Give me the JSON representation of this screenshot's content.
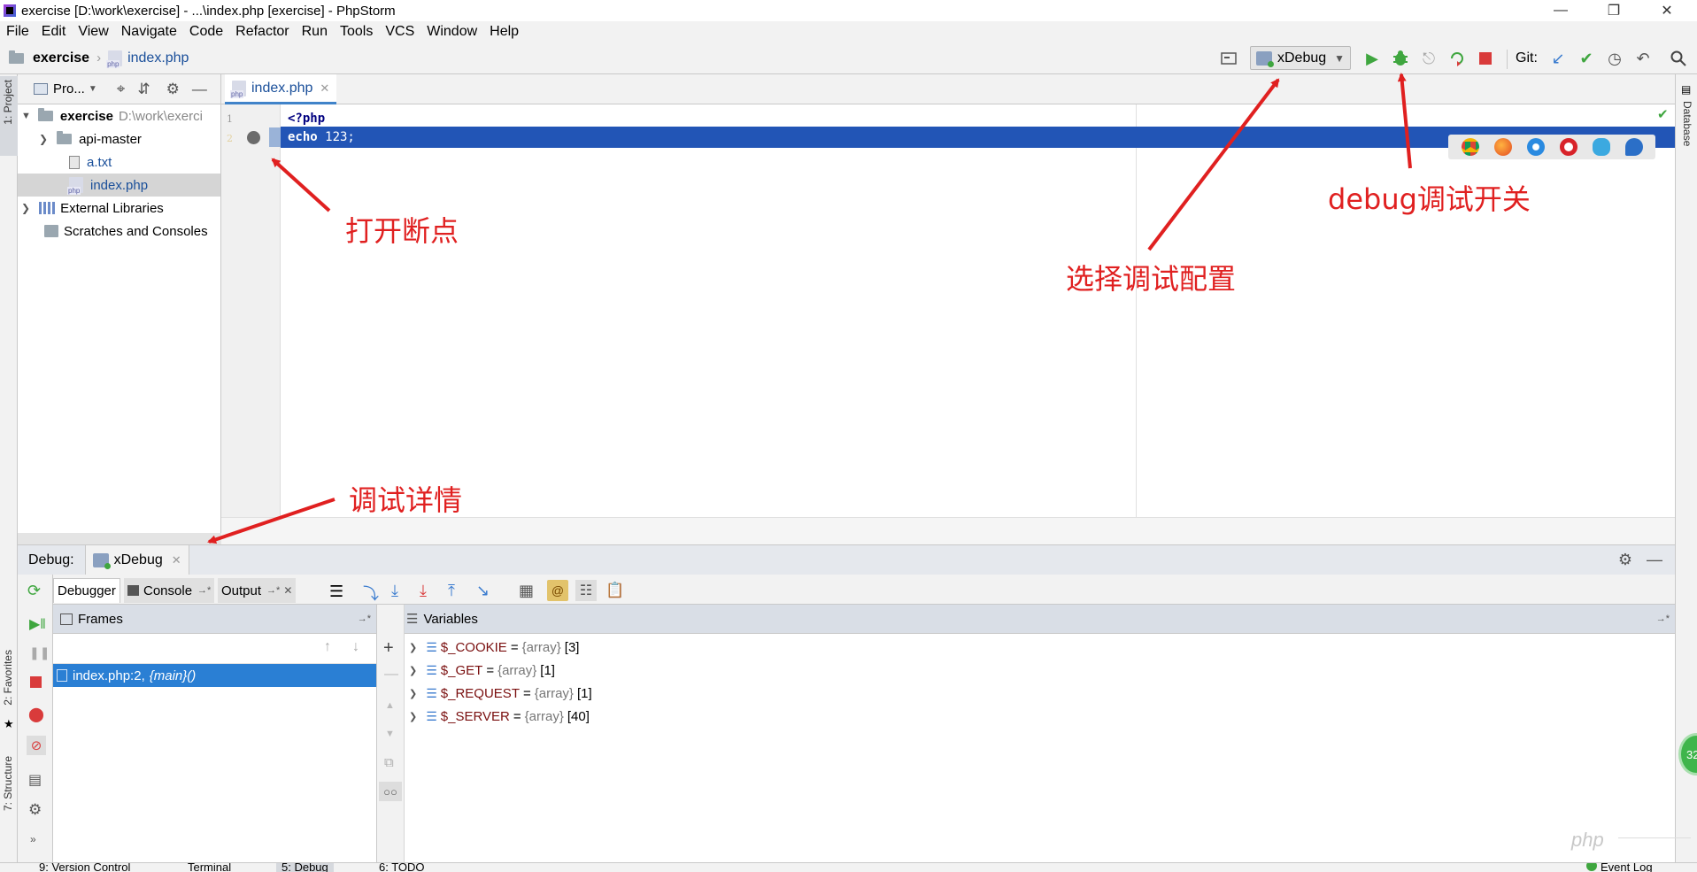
{
  "window": {
    "title": "exercise [D:\\work\\exercise] - ...\\index.php [exercise] - PhpStorm"
  },
  "menu": [
    "File",
    "Edit",
    "View",
    "Navigate",
    "Code",
    "Refactor",
    "Run",
    "Tools",
    "VCS",
    "Window",
    "Help"
  ],
  "breadcrumb": {
    "project": "exercise",
    "file": "index.php"
  },
  "toolbar": {
    "config_name": "xDebug",
    "git_label": "Git:"
  },
  "left_strip": {
    "project": "1: Project",
    "favorites": "2: Favorites",
    "structure": "7: Structure"
  },
  "right_strip": {
    "database": "Database"
  },
  "project_panel": {
    "header": "Pro...",
    "tree": [
      {
        "label": "exercise",
        "path": "D:\\work\\exerci"
      },
      {
        "label": "api-master"
      },
      {
        "label": "a.txt"
      },
      {
        "label": "index.php"
      },
      {
        "label": "External Libraries"
      },
      {
        "label": "Scratches and Consoles"
      }
    ]
  },
  "editor": {
    "tab": "index.php",
    "lines": [
      {
        "num": "1",
        "code": "<?php"
      },
      {
        "num": "2",
        "kw": "echo",
        "code": " 123;"
      }
    ]
  },
  "debug": {
    "label": "Debug:",
    "config": "xDebug",
    "tabs": {
      "debugger": "Debugger",
      "console": "Console",
      "output": "Output"
    },
    "frames": {
      "header": "Frames",
      "items": [
        {
          "file": "index.php:2,",
          "func": "{main}()"
        }
      ]
    },
    "variables": {
      "header": "Variables",
      "items": [
        {
          "name": "$_COOKIE",
          "type": "{array}",
          "count": "[3]"
        },
        {
          "name": "$_GET",
          "type": "{array}",
          "count": "[1]"
        },
        {
          "name": "$_REQUEST",
          "type": "{array}",
          "count": "[1]"
        },
        {
          "name": "$_SERVER",
          "type": "{array}",
          "count": "[40]"
        }
      ]
    }
  },
  "statusbar": {
    "vcs": "9: Version Control",
    "terminal": "Terminal",
    "debug": "5: Debug",
    "todo": "6: TODO",
    "eventlog": "Event Log"
  },
  "badge": {
    "count": "32"
  },
  "watermark": "php",
  "annotations": {
    "breakpoint": "打开断点",
    "config": "选择调试配置",
    "debug_switch": "debug调试开关",
    "details": "调试详情"
  },
  "colors": {
    "annotation": "#e02020",
    "selection": "#2255b6",
    "frame_selected": "#2a7fd4",
    "run_green": "#3fa63f",
    "stop_red": "#d93b3b"
  }
}
